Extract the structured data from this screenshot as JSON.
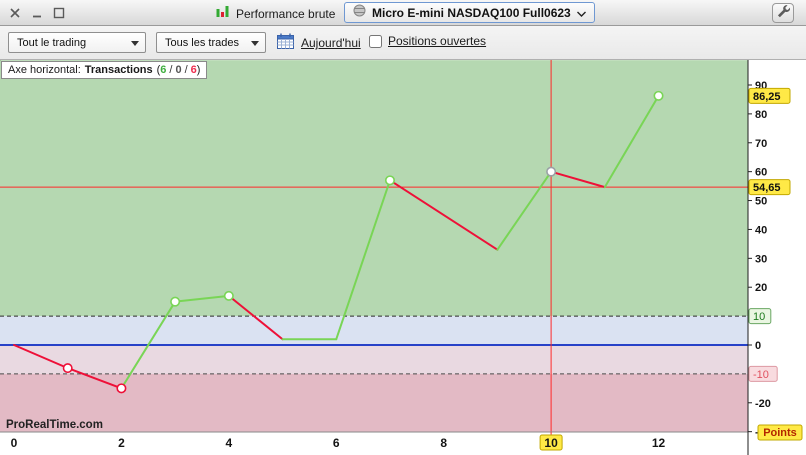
{
  "titlebar": {
    "performance_label": "Performance brute",
    "instrument_label": "Micro E-mini NASDAQ100 Full0623"
  },
  "toolbar": {
    "scope_value": "Tout le trading",
    "trades_value": "Tous les trades",
    "today_label": "Aujourd'hui",
    "positions_label": "Positions ouvertes",
    "positions_checked": false
  },
  "chart_header": {
    "axis_prefix": "Axe horizontal:",
    "axis_name": "Transactions",
    "paren_open": "(",
    "sep": "/",
    "paren_close": ")",
    "wins": "6",
    "flat": "0",
    "losses": "6",
    "watermark": "ProRealTime.com",
    "colors": {
      "wins": "#3fae3f",
      "flat": "#555555",
      "losses": "#ee2d4e"
    }
  },
  "chart_data": {
    "type": "line",
    "title": "Performance brute",
    "x_axis_name": "Transactions",
    "y_unit": "Points",
    "xlim": [
      -0.26,
      13.67
    ],
    "ylim": [
      -30.4,
      98.6
    ],
    "xticks": [
      0,
      2,
      4,
      6,
      8,
      10,
      12
    ],
    "yticks": [
      90,
      80,
      70,
      60,
      50,
      40,
      30,
      20,
      10,
      0,
      -10,
      -20,
      -30
    ],
    "highlighted_xtick": 10,
    "zones": [
      {
        "from": 10,
        "to": 98.6,
        "color": "#b5d8b1"
      },
      {
        "from": 0,
        "to": 10,
        "color": "#dae2f2"
      },
      {
        "from": -10,
        "to": 0,
        "color": "#e9d9e1"
      },
      {
        "from": -30.4,
        "to": -10,
        "color": "#e3bac5"
      }
    ],
    "boundary_upper": 10,
    "boundary_lower": -10,
    "zero_line_color": "#2742c8",
    "crosshair_x": 10,
    "crosshair_color": "#ff2a2a",
    "current_value_line": {
      "y": 54.65,
      "color": "#ff2a2a"
    },
    "points": [
      {
        "x": 0,
        "y": 0
      },
      {
        "x": 1,
        "y": -8,
        "marker": "red"
      },
      {
        "x": 2,
        "y": -15,
        "marker": "red"
      },
      {
        "x": 3,
        "y": 15,
        "marker": "green"
      },
      {
        "x": 4,
        "y": 17,
        "marker": "green"
      },
      {
        "x": 5,
        "y": 2
      },
      {
        "x": 6,
        "y": 2
      },
      {
        "x": 7,
        "y": 57,
        "marker": "green"
      },
      {
        "x": 9,
        "y": 33
      },
      {
        "x": 10,
        "y": 60,
        "marker": "gray"
      },
      {
        "x": 11,
        "y": 54.65
      },
      {
        "x": 12,
        "y": 86.25,
        "marker": "green"
      }
    ],
    "segment_colors": [
      "red",
      "red",
      "green",
      "green",
      "red",
      "green",
      "green",
      "red",
      "green",
      "red",
      "green"
    ],
    "colors": {
      "green": "#79d556",
      "red": "#ee1038",
      "gray": "#9aa0a6"
    },
    "y_badges": [
      {
        "value": 10,
        "label": "10",
        "bg": "#eaf6e2",
        "border": "#6aa763",
        "color": "#1e7a1e",
        "bold": false
      },
      {
        "value": -10,
        "label": "-10",
        "bg": "#f8dbdf",
        "border": "#dd99a2",
        "color": "#e05160",
        "bold": false
      },
      {
        "value": 86.25,
        "label": "86,25",
        "bg": "#ffe946",
        "border": "#c2a800",
        "color": "#111111",
        "bold": true
      },
      {
        "value": 54.65,
        "label": "54,65",
        "bg": "#ffe946",
        "border": "#c2a800",
        "color": "#111111",
        "bold": true
      }
    ],
    "unit_badge": {
      "label": "Points",
      "bg": "#ffe946",
      "border": "#c2a800",
      "color": "#b32500"
    },
    "xtick_highlight": {
      "bg": "#ffe946",
      "border": "#c2a800"
    }
  }
}
